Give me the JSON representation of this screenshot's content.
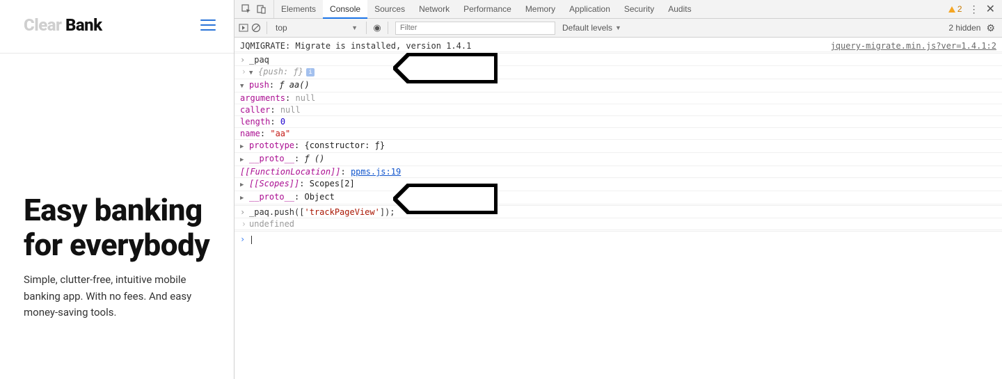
{
  "site": {
    "logo_light": "Clear",
    "logo_dark": " Bank",
    "hero_title": "Easy banking for everybody",
    "hero_sub": "Simple, clutter-free, intuitive mobile banking app. With no fees. And easy money-saving tools."
  },
  "devtools": {
    "tabs": [
      "Elements",
      "Console",
      "Sources",
      "Network",
      "Performance",
      "Memory",
      "Application",
      "Security",
      "Audits"
    ],
    "active_tab_index": 1,
    "warning_count": "2",
    "toolbar": {
      "context": "top",
      "filter_placeholder": "Filter",
      "levels": "Default levels",
      "hidden_text": "2 hidden"
    }
  },
  "console": {
    "first_msg": "JQMIGRATE: Migrate is installed, version 1.4.1",
    "first_link": "jquery-migrate.min.js?ver=1.4.1:2",
    "line_paq": "_paq",
    "obj_head": "{push: ƒ}",
    "push_label": "push",
    "push_val": "ƒ aa()",
    "arguments_label": "arguments",
    "arguments_val": "null",
    "caller_label": "caller",
    "caller_val": "null",
    "length_label": "length",
    "length_val": "0",
    "name_label": "name",
    "name_val": "\"aa\"",
    "proto1_label": "prototype",
    "proto1_val": "{constructor: ƒ}",
    "proto2_label": "__proto__",
    "proto2_val": "ƒ ()",
    "funcloc_label": "[[FunctionLocation]]",
    "funcloc_val": "ppms.js:19",
    "scopes_label": "[[Scopes]]",
    "scopes_val": "Scopes[2]",
    "outer_proto_label": "__proto__",
    "outer_proto_val": "Object",
    "input2_pre": "_paq.push([",
    "input2_str": "'trackPageView'",
    "input2_post": "]);",
    "undefined": "undefined"
  }
}
